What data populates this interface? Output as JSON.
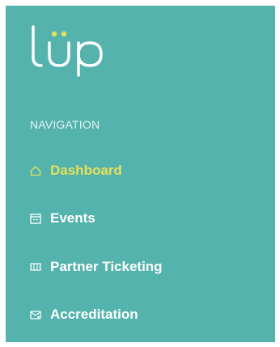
{
  "logo": {
    "text": "lüp",
    "accent_color": "#e5e05a"
  },
  "navigation": {
    "section_label": "NAVIGATION",
    "items": [
      {
        "label": "Dashboard",
        "icon": "home-icon",
        "active": true
      },
      {
        "label": "Events",
        "icon": "calendar-icon",
        "active": false
      },
      {
        "label": "Partner Ticketing",
        "icon": "ticket-icon",
        "active": false
      },
      {
        "label": "Accreditation",
        "icon": "badge-icon",
        "active": false
      }
    ]
  },
  "colors": {
    "sidebar_bg": "#55b3ad",
    "active": "#e5e05a",
    "text": "#ffffff"
  }
}
